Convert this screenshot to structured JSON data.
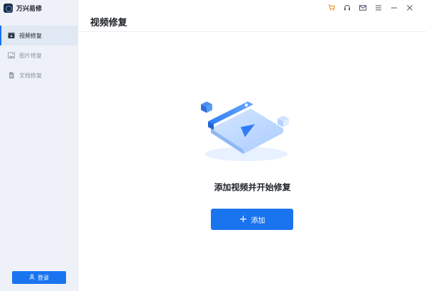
{
  "app": {
    "name": "万兴易修"
  },
  "sidebar": {
    "items": [
      {
        "label": "视频修复",
        "icon": "video-icon",
        "active": true
      },
      {
        "label": "图片修复",
        "icon": "image-icon",
        "active": false
      },
      {
        "label": "文档修复",
        "icon": "document-icon",
        "active": false
      }
    ],
    "login_label": "登录"
  },
  "header": {
    "title": "视频修复"
  },
  "title_bar_icons": [
    "cart-icon",
    "headset-icon",
    "mail-icon",
    "menu-icon",
    "minimize-icon",
    "close-icon"
  ],
  "main": {
    "message": "添加视频并开始修复",
    "add_button_label": "添加"
  },
  "colors": {
    "accent": "#1a74f0",
    "sidebar_bg": "#eef2f8",
    "cart": "#f08a24"
  }
}
